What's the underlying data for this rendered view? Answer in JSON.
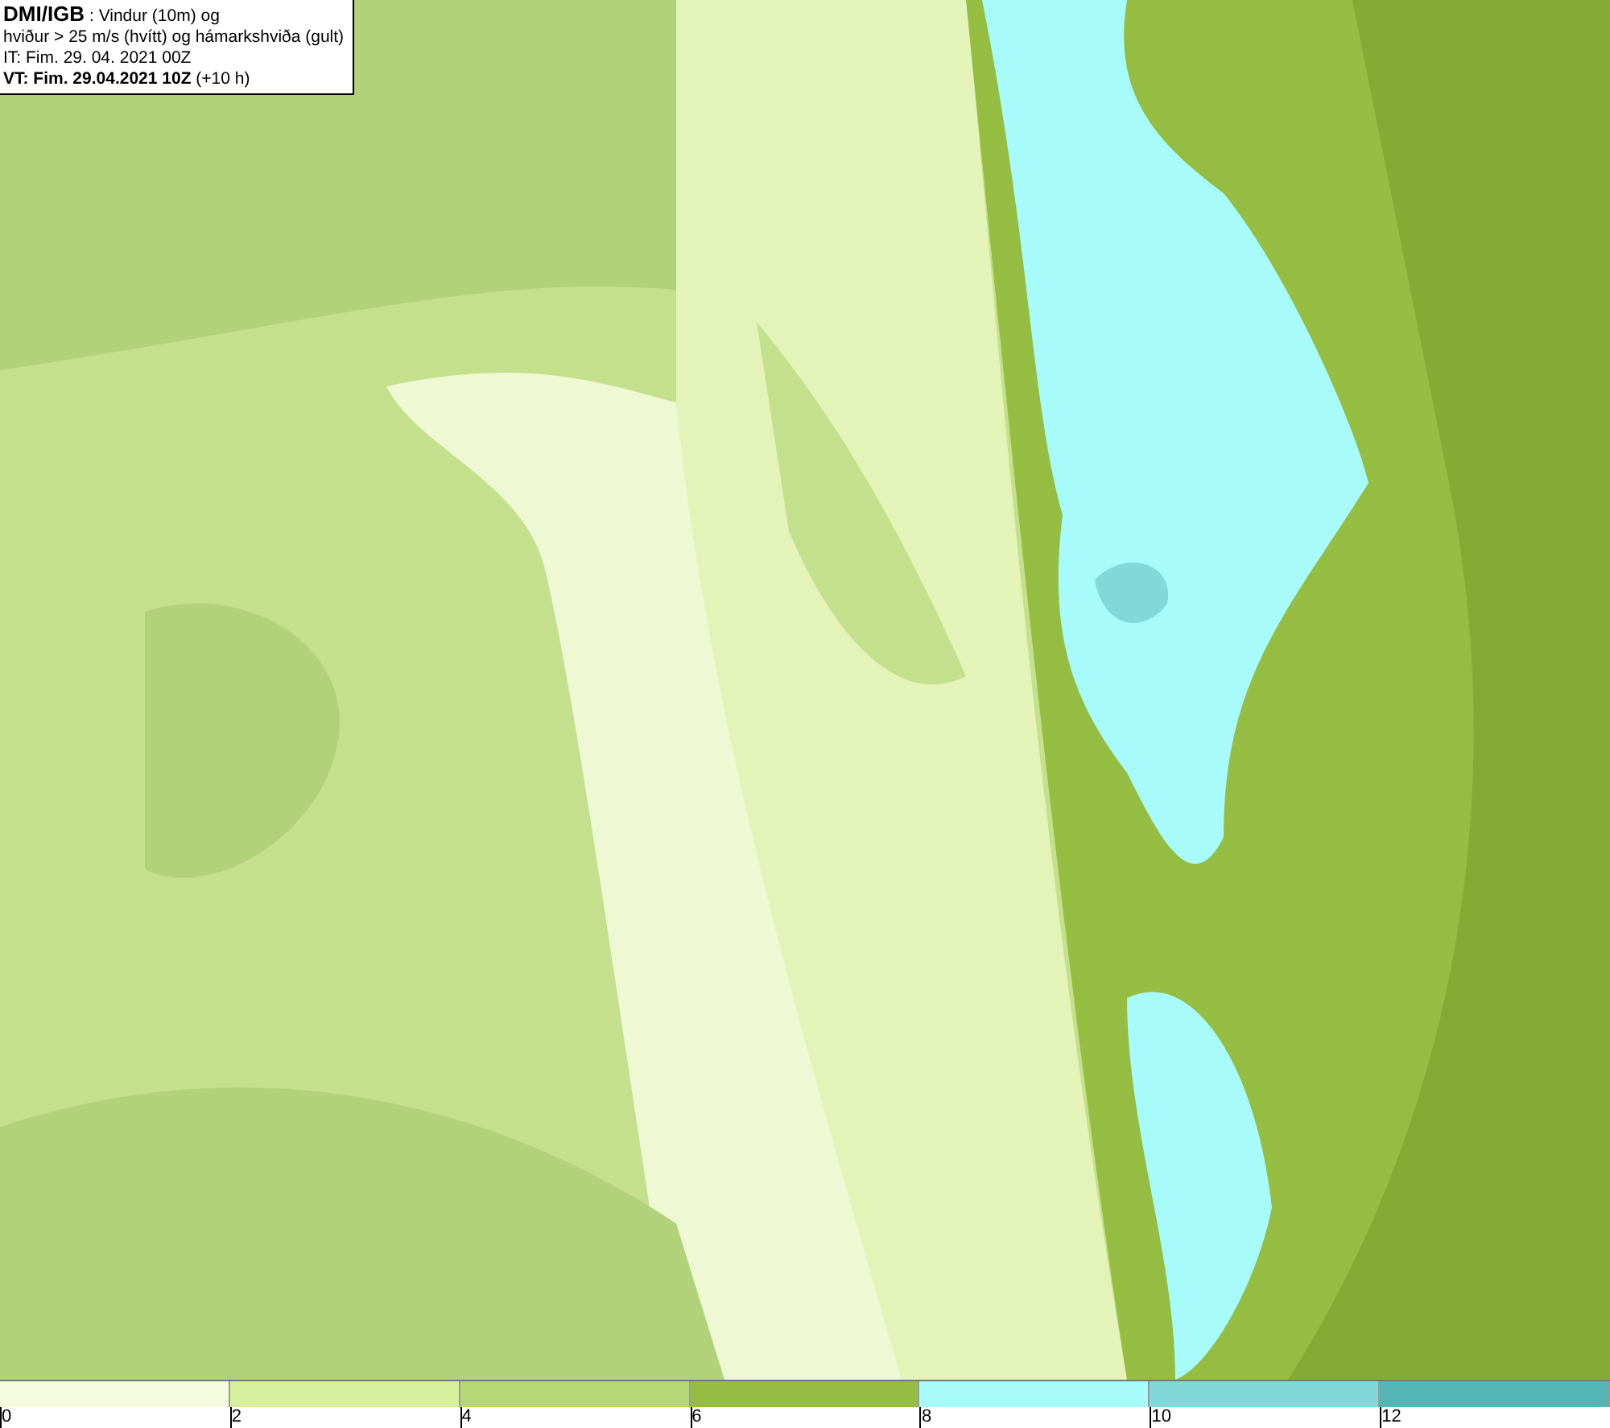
{
  "header": {
    "lines": [
      "**DMI/IGB** : Vindur (10m) og",
      "hviður > 25 m/s (hvítt) og hámarkshviða (gult)",
      "IT: Fim. 29. 04. 2021 00Z",
      "**VT: Fim. 29.04.2021 10Z** (+10 h)"
    ]
  },
  "legend": [
    {
      "label": "0",
      "color": "#f4fbdf"
    },
    {
      "label": "2",
      "color": "#d8efa0"
    },
    {
      "label": "4",
      "color": "#b6d874"
    },
    {
      "label": "6",
      "color": "#95bd42"
    },
    {
      "label": "8",
      "color": "#a8fbfb"
    },
    {
      "label": "10",
      "color": "#80d8d8"
    },
    {
      "label": "12",
      "color": "#55b4b4"
    }
  ]
}
